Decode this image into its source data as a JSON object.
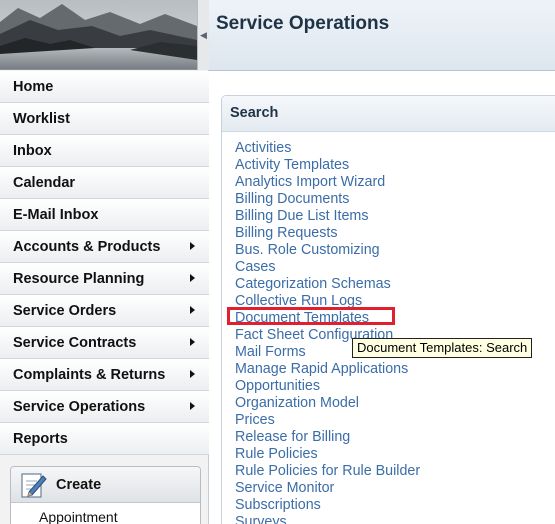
{
  "header": {
    "title": "Service Operations"
  },
  "nav": {
    "items": [
      {
        "label": "Home",
        "has_submenu": false
      },
      {
        "label": "Worklist",
        "has_submenu": false
      },
      {
        "label": "Inbox",
        "has_submenu": false
      },
      {
        "label": "Calendar",
        "has_submenu": false
      },
      {
        "label": "E-Mail Inbox",
        "has_submenu": false
      },
      {
        "label": "Accounts & Products",
        "has_submenu": true
      },
      {
        "label": "Resource Planning",
        "has_submenu": true
      },
      {
        "label": "Service Orders",
        "has_submenu": true
      },
      {
        "label": "Service Contracts",
        "has_submenu": true
      },
      {
        "label": "Complaints & Returns",
        "has_submenu": true
      },
      {
        "label": "Service Operations",
        "has_submenu": true
      },
      {
        "label": "Reports",
        "has_submenu": false
      }
    ]
  },
  "create": {
    "label": "Create",
    "items": [
      "Appointment"
    ]
  },
  "search": {
    "title": "Search",
    "links": [
      "Activities",
      "Activity Templates",
      "Analytics Import Wizard",
      "Billing Documents",
      "Billing Due List Items",
      "Billing Requests",
      "Bus. Role Customizing",
      "Cases",
      "Categorization Schemas",
      "Collective Run Logs",
      "Document Templates",
      "Fact Sheet Configuration",
      "Mail Forms",
      "Manage Rapid Applications",
      "Opportunities",
      "Organization Model",
      "Prices",
      "Release for Billing",
      "Rule Policies",
      "Rule Policies for Rule Builder",
      "Service Monitor",
      "Subscriptions",
      "Surveys"
    ]
  },
  "tooltip": {
    "text": "Document Templates: Search"
  },
  "colors": {
    "link": "#3b6da7",
    "highlight": "#e0202c",
    "tooltip_bg": "#ffffe1"
  }
}
